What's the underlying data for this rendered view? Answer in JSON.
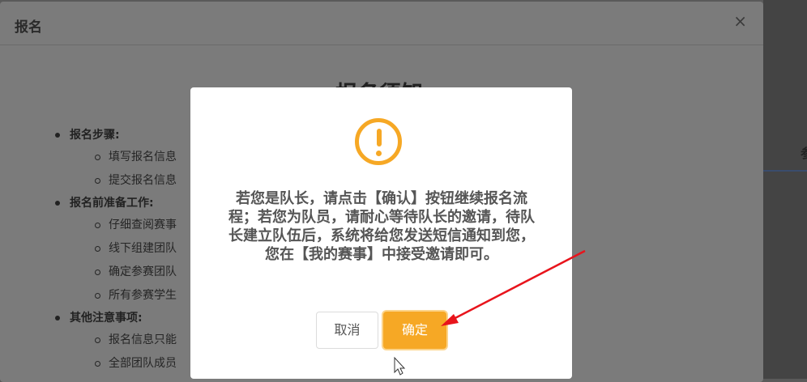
{
  "outer_modal": {
    "title": "报名",
    "close": "×",
    "notice_heading": "报名须知",
    "sections": [
      {
        "title": "报名步骤:",
        "items": [
          "填写报名信息",
          "提交报名信息"
        ]
      },
      {
        "title": "报名前准备工作:",
        "items": [
          "仔细查阅赛事",
          "线下组建团队",
          "确定参赛团队",
          "所有参赛学生"
        ]
      },
      {
        "title": "其他注意事项:",
        "items": [
          "报名信息只能",
          "全部团队成员"
        ]
      }
    ]
  },
  "background": {
    "right_fragment": "参"
  },
  "confirm_dialog": {
    "icon": "warning-circle-icon",
    "message": "若您是队长，请点击【确认】按钮继续报名流程；若您为队员，请耐心等待队长的邀请，待队长建立队伍后，系统将给您发送短信通知到您，您在【我的赛事】中接受邀请即可。",
    "cancel_label": "取消",
    "ok_label": "确定"
  },
  "colors": {
    "accent": "#f6a825",
    "annotation": "#e8141c",
    "overlay": "#7b7b7b"
  }
}
